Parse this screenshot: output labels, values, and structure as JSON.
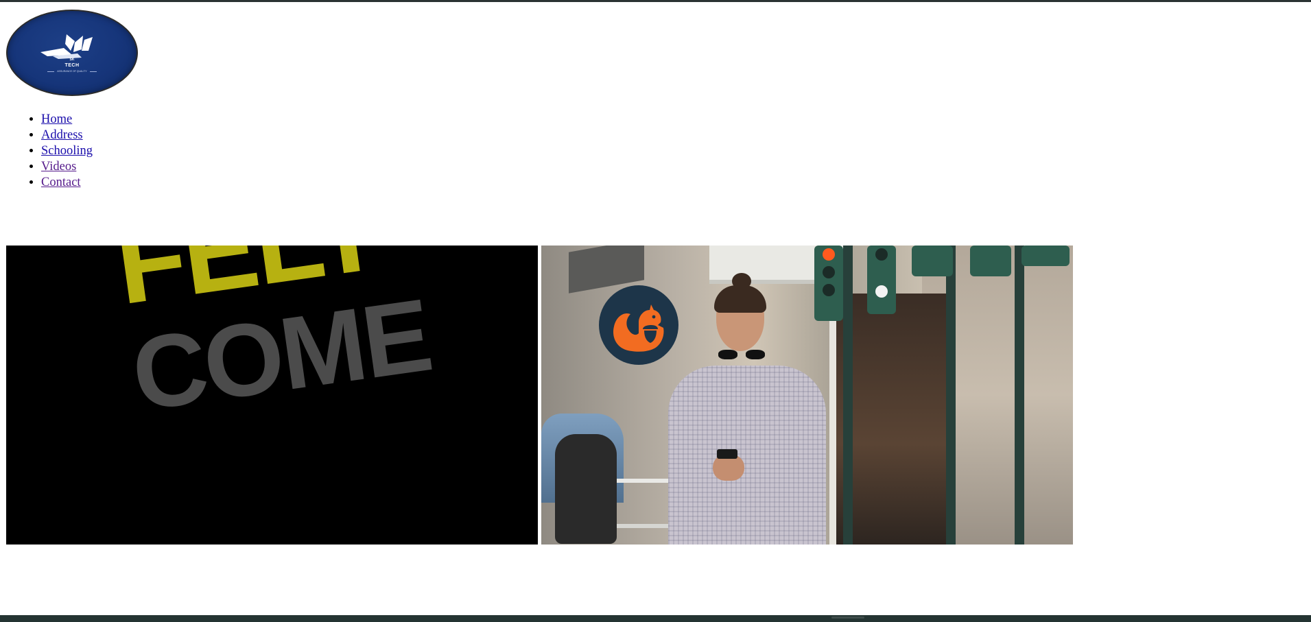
{
  "logo": {
    "line1": "SK",
    "line2": "TECH",
    "tagline": "ASSURANCE OF QUALITY"
  },
  "nav": {
    "items": [
      {
        "label": "Home",
        "visited": false
      },
      {
        "label": "Address",
        "visited": false
      },
      {
        "label": "Schooling",
        "visited": false
      },
      {
        "label": "Videos",
        "visited": true
      },
      {
        "label": "Contact",
        "visited": true
      }
    ]
  },
  "videos": {
    "left": {
      "word1": "FELT",
      "word2": "COME"
    },
    "right": {
      "badge_icon": "squirrel-icon"
    }
  },
  "colors": {
    "logo_bg": "#16357a",
    "link": "#1a0dab",
    "link_visited": "#551a8b",
    "felt_yellow": "#b7b111",
    "come_gray": "#4b4b4b",
    "squirrel_orange": "#f26c21",
    "badge_navy": "#1d3549",
    "footer": "#243432"
  }
}
